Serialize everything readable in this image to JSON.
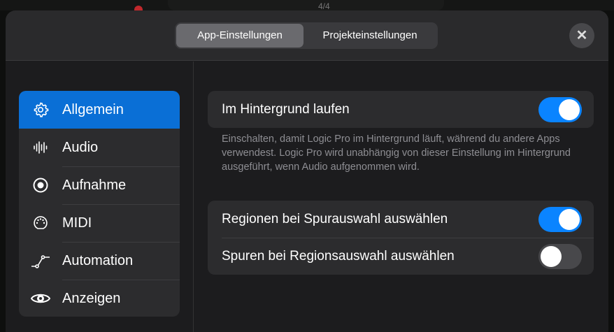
{
  "background": {
    "time_signature": "4/4"
  },
  "header": {
    "tabs": [
      {
        "label": "App-Einstellungen",
        "selected": true
      },
      {
        "label": "Projekteinstellungen",
        "selected": false
      }
    ],
    "close_label": "✕"
  },
  "sidebar": {
    "items": [
      {
        "label": "Allgemein",
        "icon": "gear-icon",
        "selected": true
      },
      {
        "label": "Audio",
        "icon": "waveform-icon"
      },
      {
        "label": "Aufnahme",
        "icon": "record-icon"
      },
      {
        "label": "MIDI",
        "icon": "midi-port-icon"
      },
      {
        "label": "Automation",
        "icon": "automation-icon"
      },
      {
        "label": "Anzeigen",
        "icon": "eye-icon"
      }
    ]
  },
  "settings": {
    "background": {
      "label": "Im Hintergrund laufen",
      "on": true,
      "description": "Einschalten, damit Logic Pro im Hintergrund läuft, während du andere Apps verwendest. Logic Pro wird unabhängig von dieser Einstellung im Hintergrund ausgeführt, wenn Audio aufgenommen wird."
    },
    "selection": [
      {
        "label": "Regionen bei Spurauswahl auswählen",
        "on": true
      },
      {
        "label": "Spuren bei Regionsauswahl auswählen",
        "on": false
      }
    ]
  },
  "colors": {
    "accent": "#0a6fd6",
    "toggle_on": "#0a84ff"
  }
}
